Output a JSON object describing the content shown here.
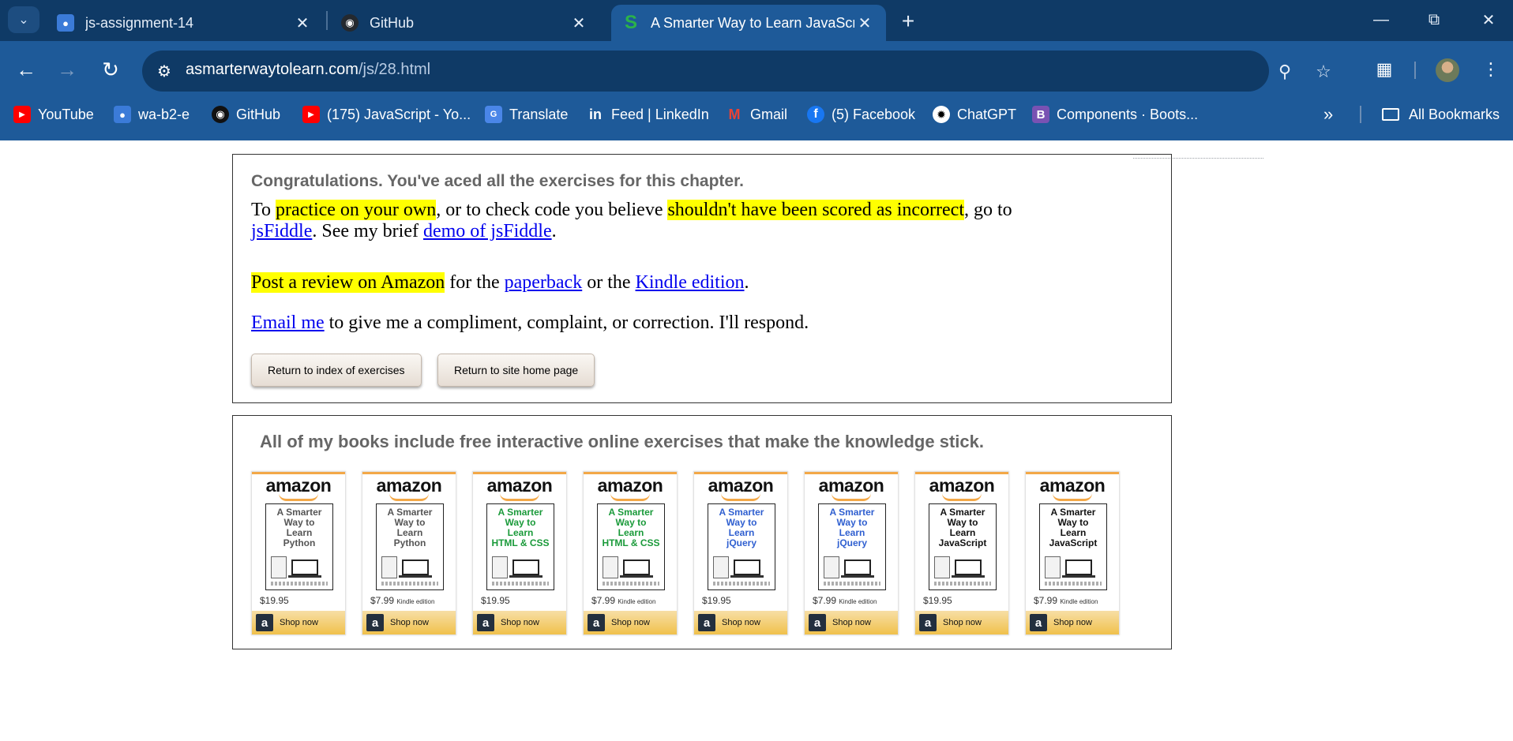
{
  "browser": {
    "tabs": [
      {
        "title": "js-assignment-14",
        "favicon": "classroom-icon",
        "active": false
      },
      {
        "title": "GitHub",
        "favicon": "github-icon",
        "active": false
      },
      {
        "title": "A Smarter Way to Learn JavaScr",
        "favicon": "smarterway-icon",
        "active": true
      }
    ],
    "url_host": "asmarterwaytolearn.com",
    "url_path": "/js/28.html",
    "bookmarks": [
      {
        "label": "YouTube",
        "icon": "youtube-icon"
      },
      {
        "label": "wa-b2-e",
        "icon": "classroom-icon"
      },
      {
        "label": "GitHub",
        "icon": "github-icon"
      },
      {
        "label": "(175) JavaScript - Yo...",
        "icon": "youtube-icon"
      },
      {
        "label": "Translate",
        "icon": "translate-icon"
      },
      {
        "label": "Feed | LinkedIn",
        "icon": "linkedin-icon"
      },
      {
        "label": "Gmail",
        "icon": "gmail-icon"
      },
      {
        "label": "(5) Facebook",
        "icon": "facebook-icon"
      },
      {
        "label": "ChatGPT",
        "icon": "chatgpt-icon"
      },
      {
        "label": "Components · Boots...",
        "icon": "bootstrap-icon"
      }
    ],
    "all_bookmarks": "All Bookmarks"
  },
  "panel1": {
    "congrats": "Congratulations. You've aced all the exercises for this chapter.",
    "p1": {
      "t1": "To ",
      "h1": "practice on your own",
      "t2": ", or to check code you believe ",
      "h2": "shouldn't have been scored as incorrect",
      "t3": ", go to",
      "l1": "jsFiddle",
      "t4": ". See my brief ",
      "l2": "demo of jsFiddle",
      "t5": "."
    },
    "p2": {
      "h1": "Post a review on Amazon",
      "t1": " for the ",
      "l1": "paperback",
      "t2": " or the ",
      "l2": "Kindle edition",
      "t3": "."
    },
    "p3": {
      "l1": "Email me",
      "t1": " to give me a compliment, complaint, or correction. I'll respond."
    },
    "btn_index": "Return to index of exercises",
    "btn_home": "Return to site home page"
  },
  "panel2": {
    "heading": "All of my books include free interactive online exercises that make the knowledge stick.",
    "amazon_word": "amazon",
    "shop_label": "Shop now",
    "amazon_logo_letter": "a",
    "books": [
      {
        "title_l1": "A Smarter",
        "title_l2": "Way to",
        "title_l3": "Learn",
        "title_l4": "Python",
        "price": "$19.95",
        "kind": "",
        "color": "#555555"
      },
      {
        "title_l1": "A Smarter",
        "title_l2": "Way to",
        "title_l3": "Learn",
        "title_l4": "Python",
        "price": "$7.99",
        "kind": "Kindle edition",
        "color": "#555555"
      },
      {
        "title_l1": "A Smarter",
        "title_l2": "Way to",
        "title_l3": "Learn",
        "title_l4": "HTML & CSS",
        "price": "$19.95",
        "kind": "",
        "color": "#1a9a3a"
      },
      {
        "title_l1": "A Smarter",
        "title_l2": "Way to",
        "title_l3": "Learn",
        "title_l4": "HTML & CSS",
        "price": "$7.99",
        "kind": "Kindle edition",
        "color": "#1a9a3a"
      },
      {
        "title_l1": "A Smarter",
        "title_l2": "Way to",
        "title_l3": "Learn",
        "title_l4": "jQuery",
        "price": "$19.95",
        "kind": "",
        "color": "#2f5fd0"
      },
      {
        "title_l1": "A Smarter",
        "title_l2": "Way to",
        "title_l3": "Learn",
        "title_l4": "jQuery",
        "price": "$7.99",
        "kind": "Kindle edition",
        "color": "#2f5fd0"
      },
      {
        "title_l1": "A Smarter",
        "title_l2": "Way to",
        "title_l3": "Learn",
        "title_l4": "JavaScript",
        "price": "$19.95",
        "kind": "",
        "color": "#111111"
      },
      {
        "title_l1": "A Smarter",
        "title_l2": "Way to",
        "title_l3": "Learn",
        "title_l4": "JavaScript",
        "price": "$7.99",
        "kind": "Kindle edition",
        "color": "#111111"
      }
    ]
  },
  "colors": {
    "tabstrip": "#0f3a66",
    "toolbar": "#1e5a99",
    "highlight": "#ffff00",
    "link": "#0000ee",
    "amazon_orange": "#f3a847"
  }
}
